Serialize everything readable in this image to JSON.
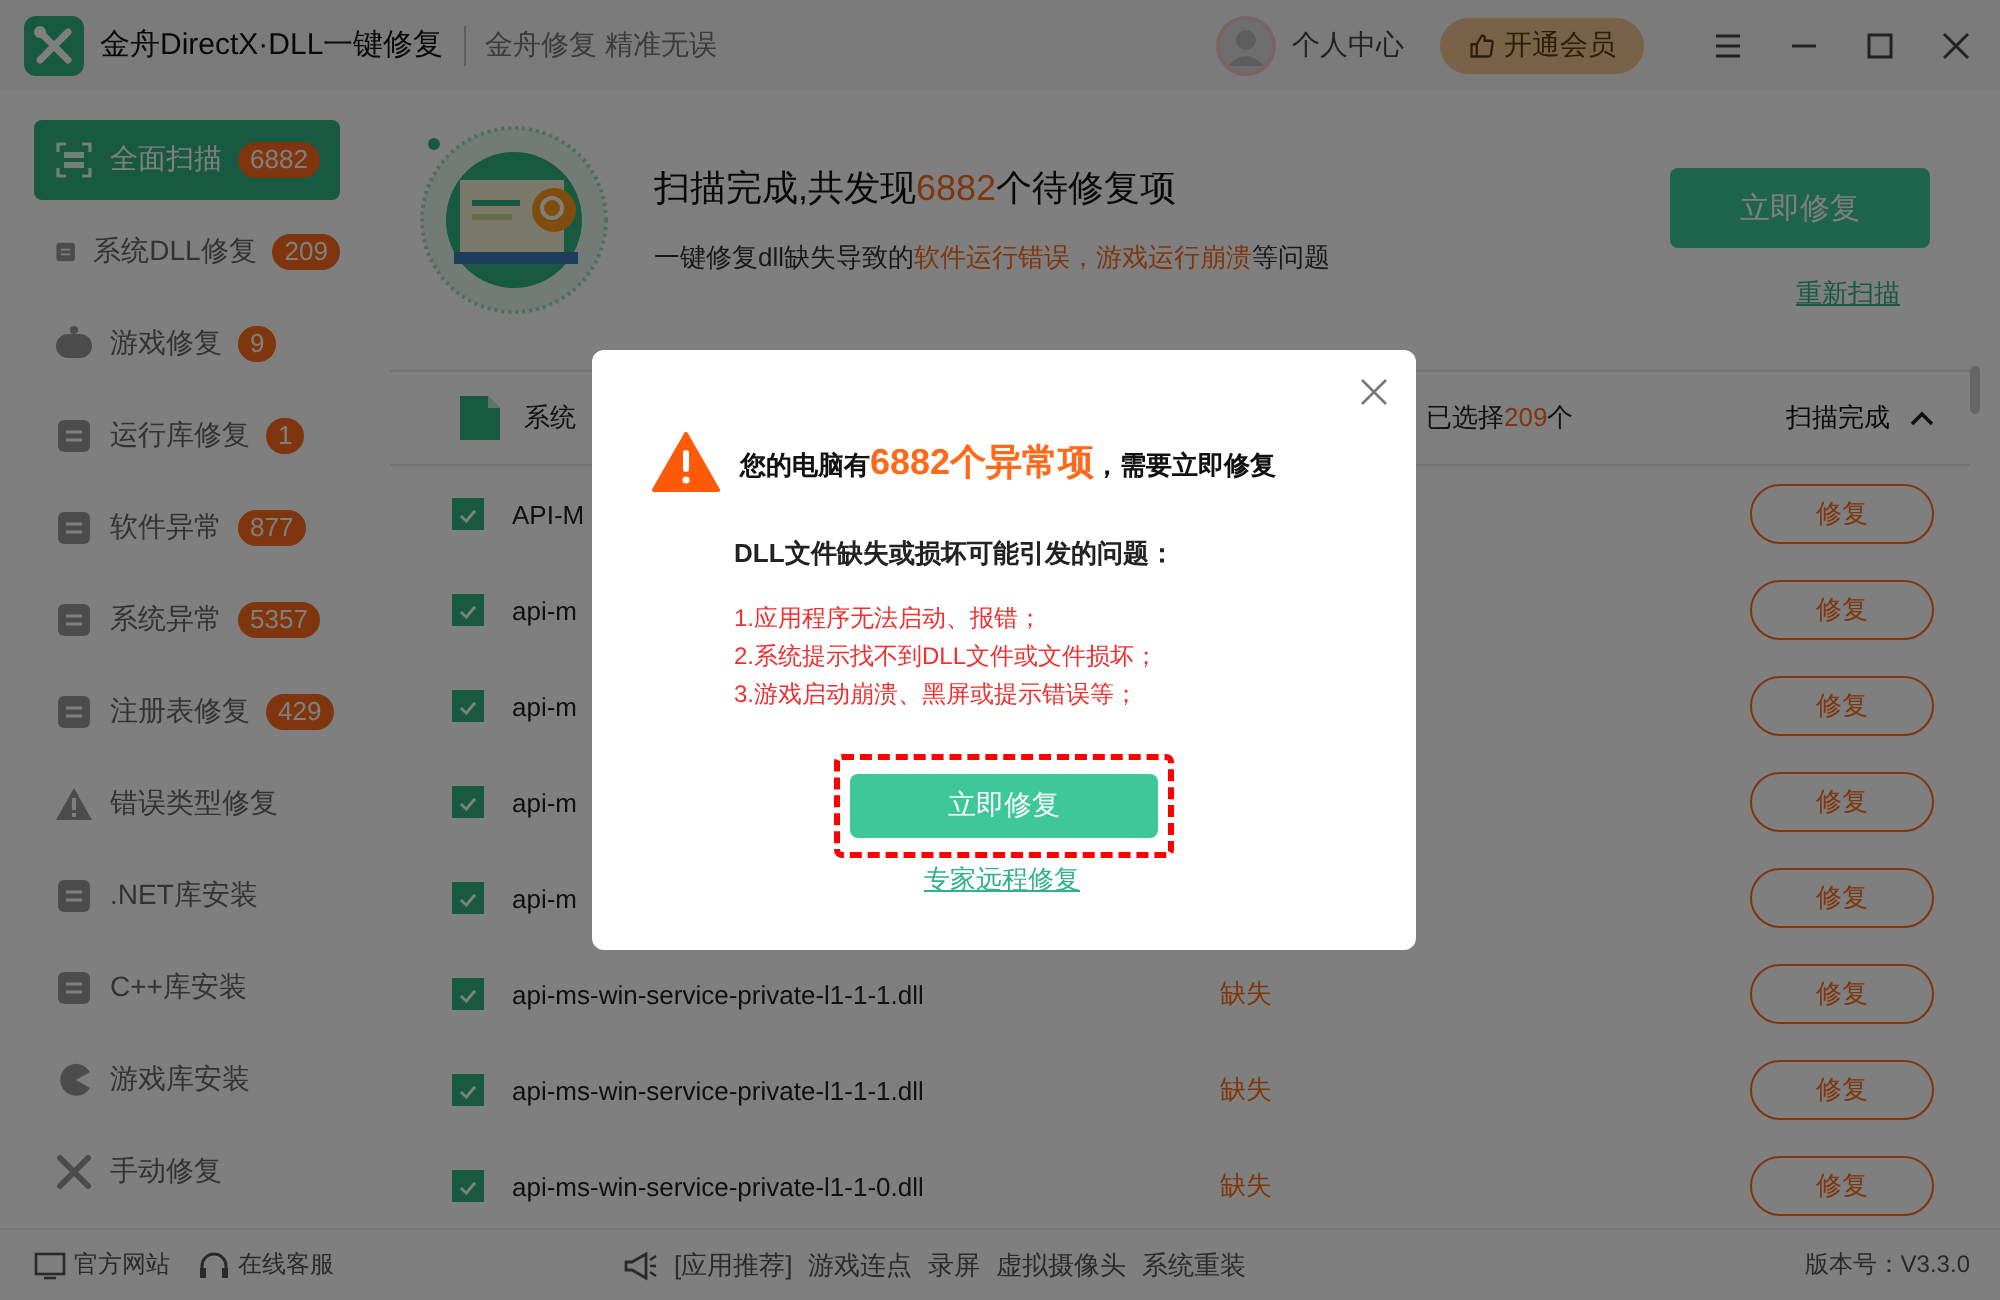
{
  "window": {
    "title": "金舟DirectX·DLL一键修复",
    "slogan": "金舟修复 精准无误",
    "user_label": "个人中心",
    "vip_button": "开通会员"
  },
  "sidebar": {
    "items": [
      {
        "label": "全面扫描",
        "count": "6882",
        "selected": true
      },
      {
        "label": "系统DLL修复",
        "count": "209",
        "selected": false
      },
      {
        "label": "游戏修复",
        "count": "9",
        "selected": false
      },
      {
        "label": "运行库修复",
        "count": "1",
        "selected": false
      },
      {
        "label": "软件异常",
        "count": "877",
        "selected": false
      },
      {
        "label": "系统异常",
        "count": "5357",
        "selected": false
      },
      {
        "label": "注册表修复",
        "count": "429",
        "selected": false
      },
      {
        "label": "错误类型修复",
        "selected": false
      },
      {
        "label": ".NET库安装",
        "selected": false
      },
      {
        "label": "C++库安装",
        "selected": false
      },
      {
        "label": "游戏库安装",
        "selected": false
      },
      {
        "label": "手动修复",
        "selected": false
      }
    ]
  },
  "summary": {
    "title": [
      {
        "text": "扫描完成,共发现",
        "highlight": false
      },
      {
        "text": "6882",
        "highlight": true
      },
      {
        "text": "个待修复项",
        "highlight": false
      }
    ],
    "subtitle": [
      {
        "text": "一键修复dll缺失导致的",
        "highlight": false
      },
      {
        "text": "软件运行错误，游戏运行崩溃",
        "highlight": true
      },
      {
        "text": "等问题",
        "highlight": false
      }
    ],
    "repair_button": "立即修复",
    "rescan_link": "重新扫描"
  },
  "table": {
    "header": {
      "category": "系统",
      "selected": [
        {
          "text": "已选择",
          "highlight": false
        },
        {
          "text": "209",
          "highlight": true
        },
        {
          "text": "个",
          "highlight": false
        }
      ],
      "status": "扫描完成",
      "expanded": true
    },
    "rows": [
      {
        "name": "API-M",
        "checked": true,
        "button": "修复"
      },
      {
        "name": "api-m",
        "checked": true,
        "button": "修复"
      },
      {
        "name": "api-m",
        "checked": true,
        "button": "修复"
      },
      {
        "name": "api-m",
        "checked": true,
        "button": "修复"
      },
      {
        "name": "api-m",
        "checked": true,
        "button": "修复"
      },
      {
        "name": "api-ms-win-service-private-l1-1-1.dll",
        "status": "缺失",
        "checked": true,
        "button": "修复"
      },
      {
        "name": "api-ms-win-service-private-l1-1-1.dll",
        "status": "缺失",
        "checked": true,
        "button": "修复"
      },
      {
        "name": "api-ms-win-service-private-l1-1-0.dll",
        "status": "缺失",
        "checked": true,
        "button": "修复"
      }
    ]
  },
  "footer": {
    "links": [
      "官方网站",
      "在线客服"
    ],
    "recommend_label": "[应用推荐]",
    "apps": [
      "游戏连点",
      "录屏",
      "虚拟摄像头",
      "系统重装"
    ],
    "version": "版本号：V3.3.0"
  },
  "dialog": {
    "headline": [
      {
        "text": "您的电脑有",
        "highlight": false
      },
      {
        "text": "6882个异常项",
        "highlight": true
      },
      {
        "text": "，需要立即修复",
        "highlight": false
      }
    ],
    "question": "DLL文件缺失或损坏可能引发的问题：",
    "issues": [
      "1.应用程序无法启动、报错；",
      "2.系统提示找不到DLL文件或文件损坏；",
      "3.游戏启动崩溃、黑屏或提示错误等；"
    ],
    "repair_button": "立即修复",
    "expert_link": "专家远程修复"
  }
}
